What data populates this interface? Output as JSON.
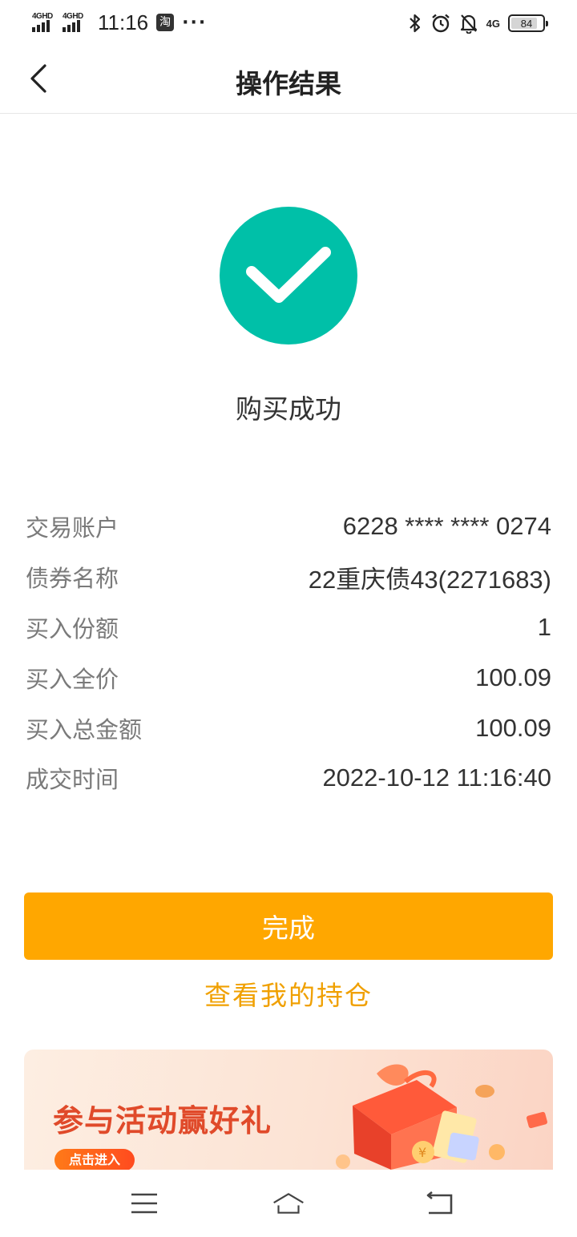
{
  "status_bar": {
    "signal1": "4GHD",
    "signal2": "4GHD",
    "time": "11:16",
    "taobao_icon_label": "淘",
    "more_dots": "···",
    "network": "4G",
    "battery": "84",
    "battery_level": 0.84,
    "icons": [
      "bluetooth-icon",
      "alarm-icon",
      "mute-bell-icon",
      "battery-icon"
    ]
  },
  "nav": {
    "title": "操作结果",
    "back_icon": "chevron-left-icon"
  },
  "result": {
    "icon": "check-icon",
    "color": "#00c0a8",
    "message": "购买成功"
  },
  "details": [
    {
      "label": "交易账户",
      "value": "6228 **** **** 0274"
    },
    {
      "label": "债券名称",
      "value": "22重庆债43(2271683)"
    },
    {
      "label": "买入份额",
      "value": "1"
    },
    {
      "label": "买入全价",
      "value": "100.09"
    },
    {
      "label": "买入总金额",
      "value": "100.09"
    },
    {
      "label": "成交时间",
      "value": "2022-10-12 11:16:40"
    }
  ],
  "actions": {
    "done_label": "完成",
    "done_color": "#ffa700",
    "holdings_label": "查看我的持仓",
    "holdings_color": "#f0a000"
  },
  "banner": {
    "title": "参与活动赢好礼",
    "cta": "点击进入",
    "art_icon": "gift-box-icon"
  },
  "bottom_nav": {
    "icons": [
      "menu-icon",
      "home-icon",
      "back-icon"
    ]
  }
}
